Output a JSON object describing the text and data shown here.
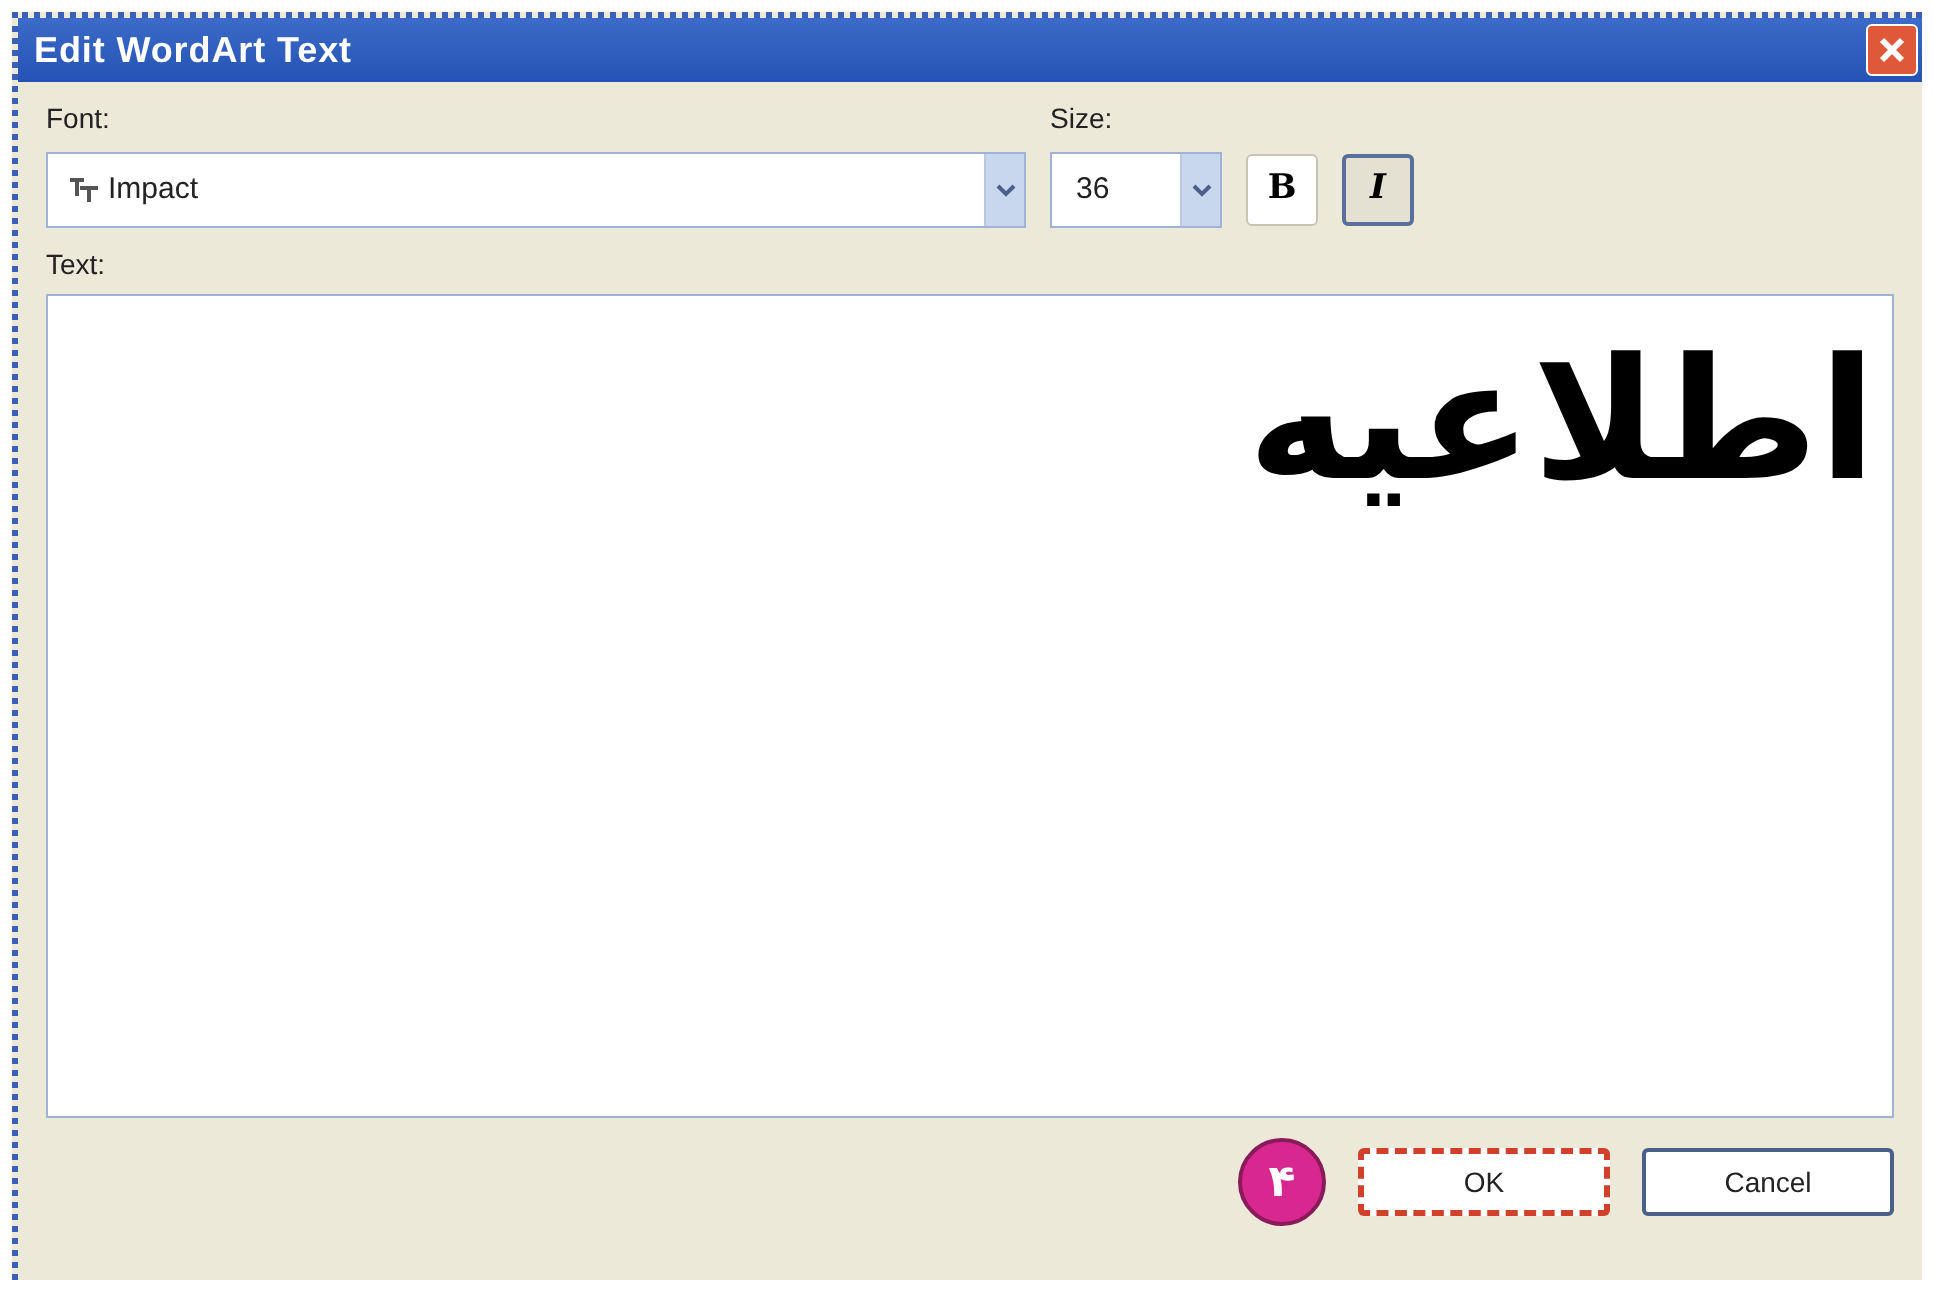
{
  "window": {
    "title": "Edit WordArt Text"
  },
  "font": {
    "label": "Font:",
    "value": "Impact"
  },
  "size": {
    "label": "Size:",
    "value": "36"
  },
  "style_buttons": [
    {
      "label": "B",
      "kind": "bold",
      "pressed": false
    },
    {
      "label": "I",
      "kind": "italic",
      "pressed": true
    }
  ],
  "text": {
    "label": "Text:",
    "value": "اطلاعیه"
  },
  "step_badge": "۴",
  "buttons": [
    {
      "label": "OK",
      "highlighted": true
    },
    {
      "label": "Cancel",
      "highlighted": false
    }
  ]
}
